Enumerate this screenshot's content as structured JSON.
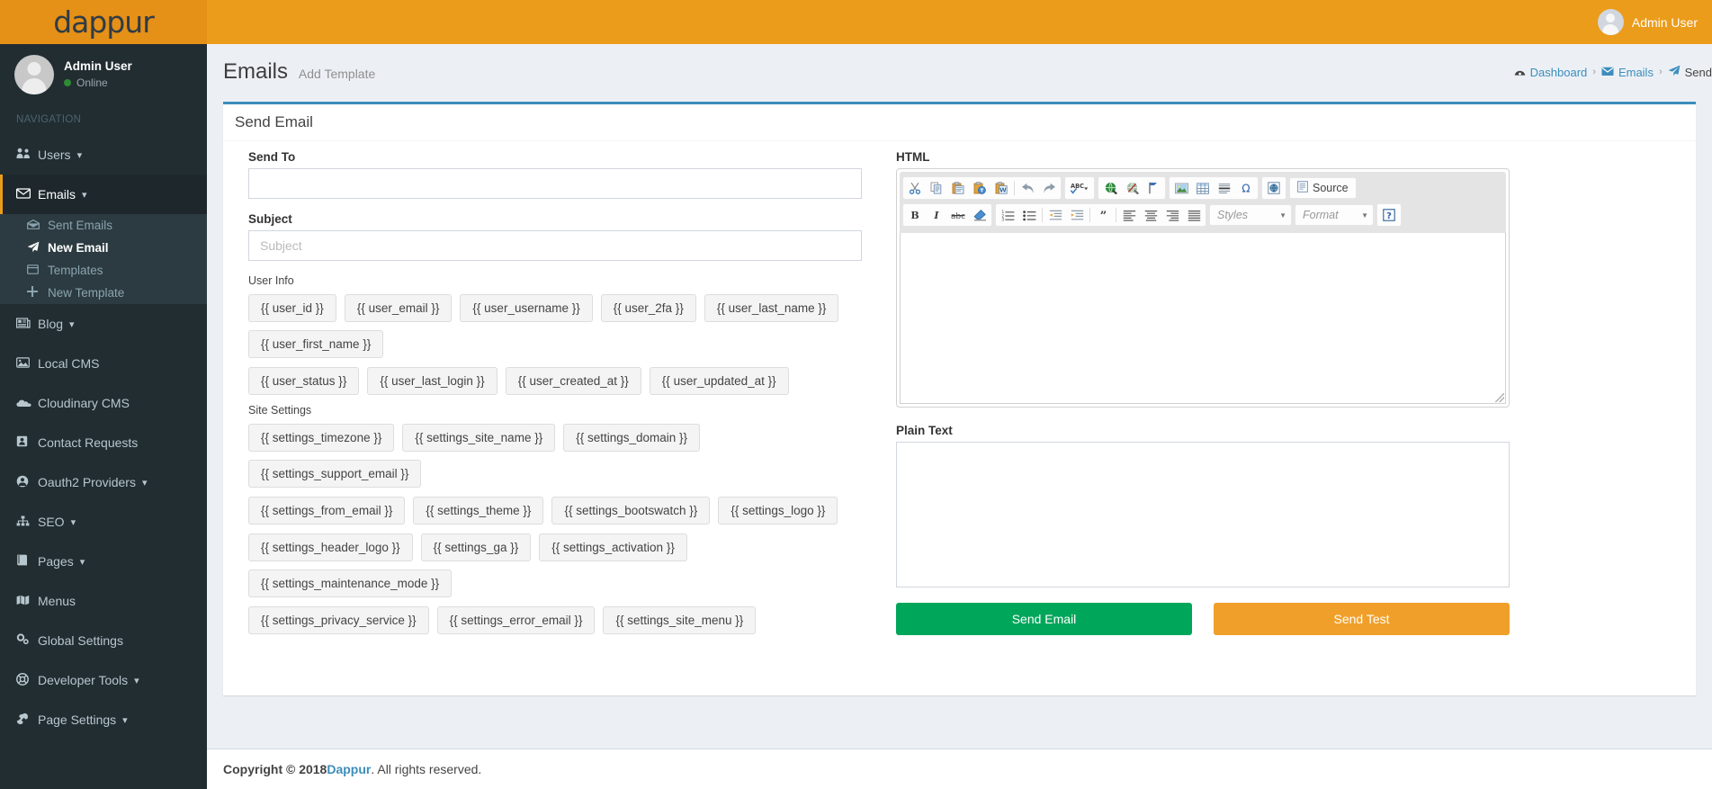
{
  "brand": {
    "logo_text": "dappur",
    "accent": "#eb9c1b",
    "sidebar_bg": "#222d32",
    "box_accent": "#3c8dbc"
  },
  "navbar": {
    "user_name": "Admin User"
  },
  "sidebar": {
    "user": {
      "name": "Admin User",
      "status": "Online"
    },
    "nav_header": "NAVIGATION",
    "items": [
      {
        "label": "Users",
        "icon": "users-icon",
        "caret": true
      },
      {
        "label": "Emails",
        "icon": "envelope-icon",
        "caret": true,
        "active": true
      },
      {
        "label": "Blog",
        "icon": "newspaper-icon",
        "caret": true
      },
      {
        "label": "Local CMS",
        "icon": "image-icon",
        "caret": false
      },
      {
        "label": "Cloudinary CMS",
        "icon": "cloud-icon",
        "caret": false
      },
      {
        "label": "Contact Requests",
        "icon": "address-card-icon",
        "caret": false
      },
      {
        "label": "Oauth2 Providers",
        "icon": "user-circle-icon",
        "caret": true
      },
      {
        "label": "SEO",
        "icon": "sitemap-icon",
        "caret": true
      },
      {
        "label": "Pages",
        "icon": "book-icon",
        "caret": true
      },
      {
        "label": "Menus",
        "icon": "map-icon",
        "caret": false
      },
      {
        "label": "Global Settings",
        "icon": "cogs-icon",
        "caret": false
      },
      {
        "label": "Developer Tools",
        "icon": "life-ring-icon",
        "caret": true
      },
      {
        "label": "Page Settings",
        "icon": "wrench-icon",
        "caret": true
      }
    ],
    "emails_subitems": [
      {
        "label": "Sent Emails",
        "icon": "envelope-open-icon",
        "active": false
      },
      {
        "label": "New Email",
        "icon": "paper-plane-icon",
        "active": true
      },
      {
        "label": "Templates",
        "icon": "window-icon",
        "active": false
      },
      {
        "label": "New Template",
        "icon": "plus-icon",
        "active": false
      }
    ]
  },
  "header": {
    "title": "Emails",
    "subtitle": "Add Template",
    "breadcrumb": [
      {
        "label": "Dashboard",
        "icon": "dashboard-icon"
      },
      {
        "label": "Emails",
        "icon": "envelope-icon"
      },
      {
        "label": "Send",
        "icon": "paper-plane-icon"
      }
    ],
    "separator": "›"
  },
  "box": {
    "title": "Send Email"
  },
  "form": {
    "send_to": {
      "label": "Send To",
      "value": "",
      "placeholder": ""
    },
    "subject": {
      "label": "Subject",
      "value": "",
      "placeholder": "Subject"
    },
    "user_info": {
      "label": "User Info",
      "tokens": [
        "{{ user_id }}",
        "{{ user_email }}",
        "{{ user_username }}",
        "{{ user_2fa }}",
        "{{ user_last_name }}",
        "{{ user_first_name }}",
        "{{ user_status }}",
        "{{ user_last_login }}",
        "{{ user_created_at }}",
        "{{ user_updated_at }}"
      ]
    },
    "site_settings": {
      "label": "Site Settings",
      "tokens": [
        "{{ settings_timezone }}",
        "{{ settings_site_name }}",
        "{{ settings_domain }}",
        "{{ settings_support_email }}",
        "{{ settings_from_email }}",
        "{{ settings_theme }}",
        "{{ settings_bootswatch }}",
        "{{ settings_logo }}",
        "{{ settings_header_logo }}",
        "{{ settings_ga }}",
        "{{ settings_activation }}",
        "{{ settings_maintenance_mode }}",
        "{{ settings_privacy_service }}",
        "{{ settings_error_email }}",
        "{{ settings_site_menu }}"
      ]
    },
    "html": {
      "label": "HTML",
      "value": ""
    },
    "plain_text": {
      "label": "Plain Text",
      "value": "",
      "placeholder": ""
    },
    "buttons": {
      "send_email": "Send Email",
      "send_test": "Send Test"
    }
  },
  "editor": {
    "toolbar_row1": [
      {
        "name": "cut-icon",
        "group": 0
      },
      {
        "name": "copy-icon",
        "group": 0
      },
      {
        "name": "paste-icon",
        "group": 0
      },
      {
        "name": "paste-text-icon",
        "group": 0
      },
      {
        "name": "paste-word-icon",
        "group": 0
      },
      {
        "name": "undo-icon",
        "group": 0
      },
      {
        "name": "redo-icon",
        "group": 0
      },
      {
        "name": "spellcheck-icon",
        "group": 1
      },
      {
        "name": "link-icon",
        "group": 2
      },
      {
        "name": "unlink-icon",
        "group": 2
      },
      {
        "name": "anchor-icon",
        "group": 2
      },
      {
        "name": "image-icon",
        "group": 3
      },
      {
        "name": "table-icon",
        "group": 3
      },
      {
        "name": "horizontal-rule-icon",
        "group": 3
      },
      {
        "name": "special-char-icon",
        "group": 3
      },
      {
        "name": "iframe-icon",
        "group": 4
      }
    ],
    "source_label": "Source",
    "toolbar_row2": [
      {
        "name": "bold-icon"
      },
      {
        "name": "italic-icon"
      },
      {
        "name": "strikethrough-icon"
      },
      {
        "name": "remove-format-icon"
      },
      {
        "name": "numbered-list-icon"
      },
      {
        "name": "bulleted-list-icon"
      },
      {
        "name": "decrease-indent-icon"
      },
      {
        "name": "increase-indent-icon"
      },
      {
        "name": "blockquote-icon"
      },
      {
        "name": "align-left-icon"
      },
      {
        "name": "align-center-icon"
      },
      {
        "name": "align-right-icon"
      },
      {
        "name": "align-justify-icon"
      }
    ],
    "styles_label": "Styles",
    "format_label": "Format",
    "help_label": "?"
  },
  "footer": {
    "copyright_prefix": "Copyright © 2018 ",
    "brand": "Dappur",
    "copyright_suffix": ". All rights reserved."
  }
}
